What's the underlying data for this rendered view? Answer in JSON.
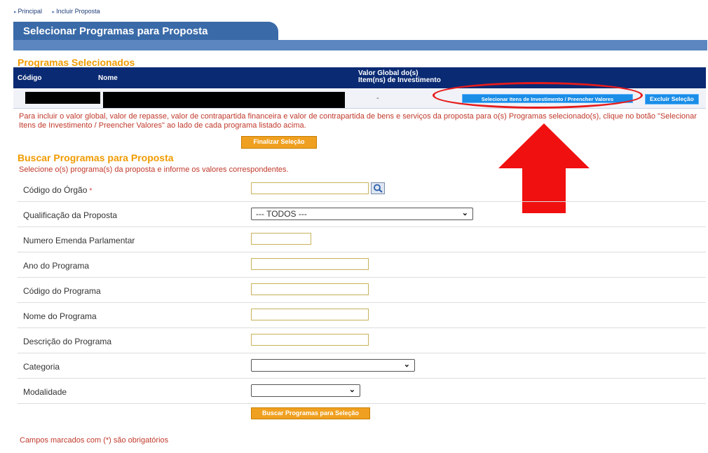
{
  "breadcrumb": {
    "items": [
      "Principal",
      "Incluir Proposta"
    ]
  },
  "page_title": "Selecionar Programas para Proposta",
  "selected": {
    "title": "Programas Selecionados",
    "headers": {
      "codigo": "Código",
      "nome": "Nome",
      "valor_line1": "Valor Global do(s)",
      "valor_line2": "Item(ns) de Investimento"
    },
    "row": {
      "valor": "-"
    },
    "select_items_button": "Selecionar Itens de Investimento / Preencher Valores",
    "exclude_button": "Excluir Seleção"
  },
  "instruction": "Para incluir o valor global, valor de repasse, valor de contrapartida financeira e valor de contrapartida de bens e serviços da proposta para o(s) Programas selecionado(s), clique no botão \"Selecionar Itens de Investimento / Preencher Valores\" ao lado de cada programa listado acima.",
  "finalize_button": "Finalizar Seleção",
  "search": {
    "title": "Buscar Programas para Proposta",
    "hint": "Selecione o(s) programa(s) da proposta e informe os valores correspondentes.",
    "fields": {
      "orgao": {
        "label": "Código do Órgão",
        "required_mark": "*",
        "value": ""
      },
      "qualificacao": {
        "label": "Qualificação da Proposta",
        "selected": "--- TODOS ---"
      },
      "emenda": {
        "label": "Numero Emenda Parlamentar",
        "value": ""
      },
      "ano": {
        "label": "Ano do Programa",
        "value": ""
      },
      "codigo": {
        "label": "Código do Programa",
        "value": ""
      },
      "nome": {
        "label": "Nome do Programa",
        "value": ""
      },
      "descricao": {
        "label": "Descrição do Programa",
        "value": ""
      },
      "categoria": {
        "label": "Categoria",
        "selected": ""
      },
      "modalidade": {
        "label": "Modalidade",
        "selected": ""
      }
    },
    "search_button": "Buscar Programas para Seleção"
  },
  "footer_note": "Campos marcados com (*) são obrigatórios",
  "colors": {
    "header_navy": "#0a2a73",
    "accent_orange": "#f09b00",
    "highlight_red": "#e61b1b",
    "button_blue": "#1a8de6"
  }
}
